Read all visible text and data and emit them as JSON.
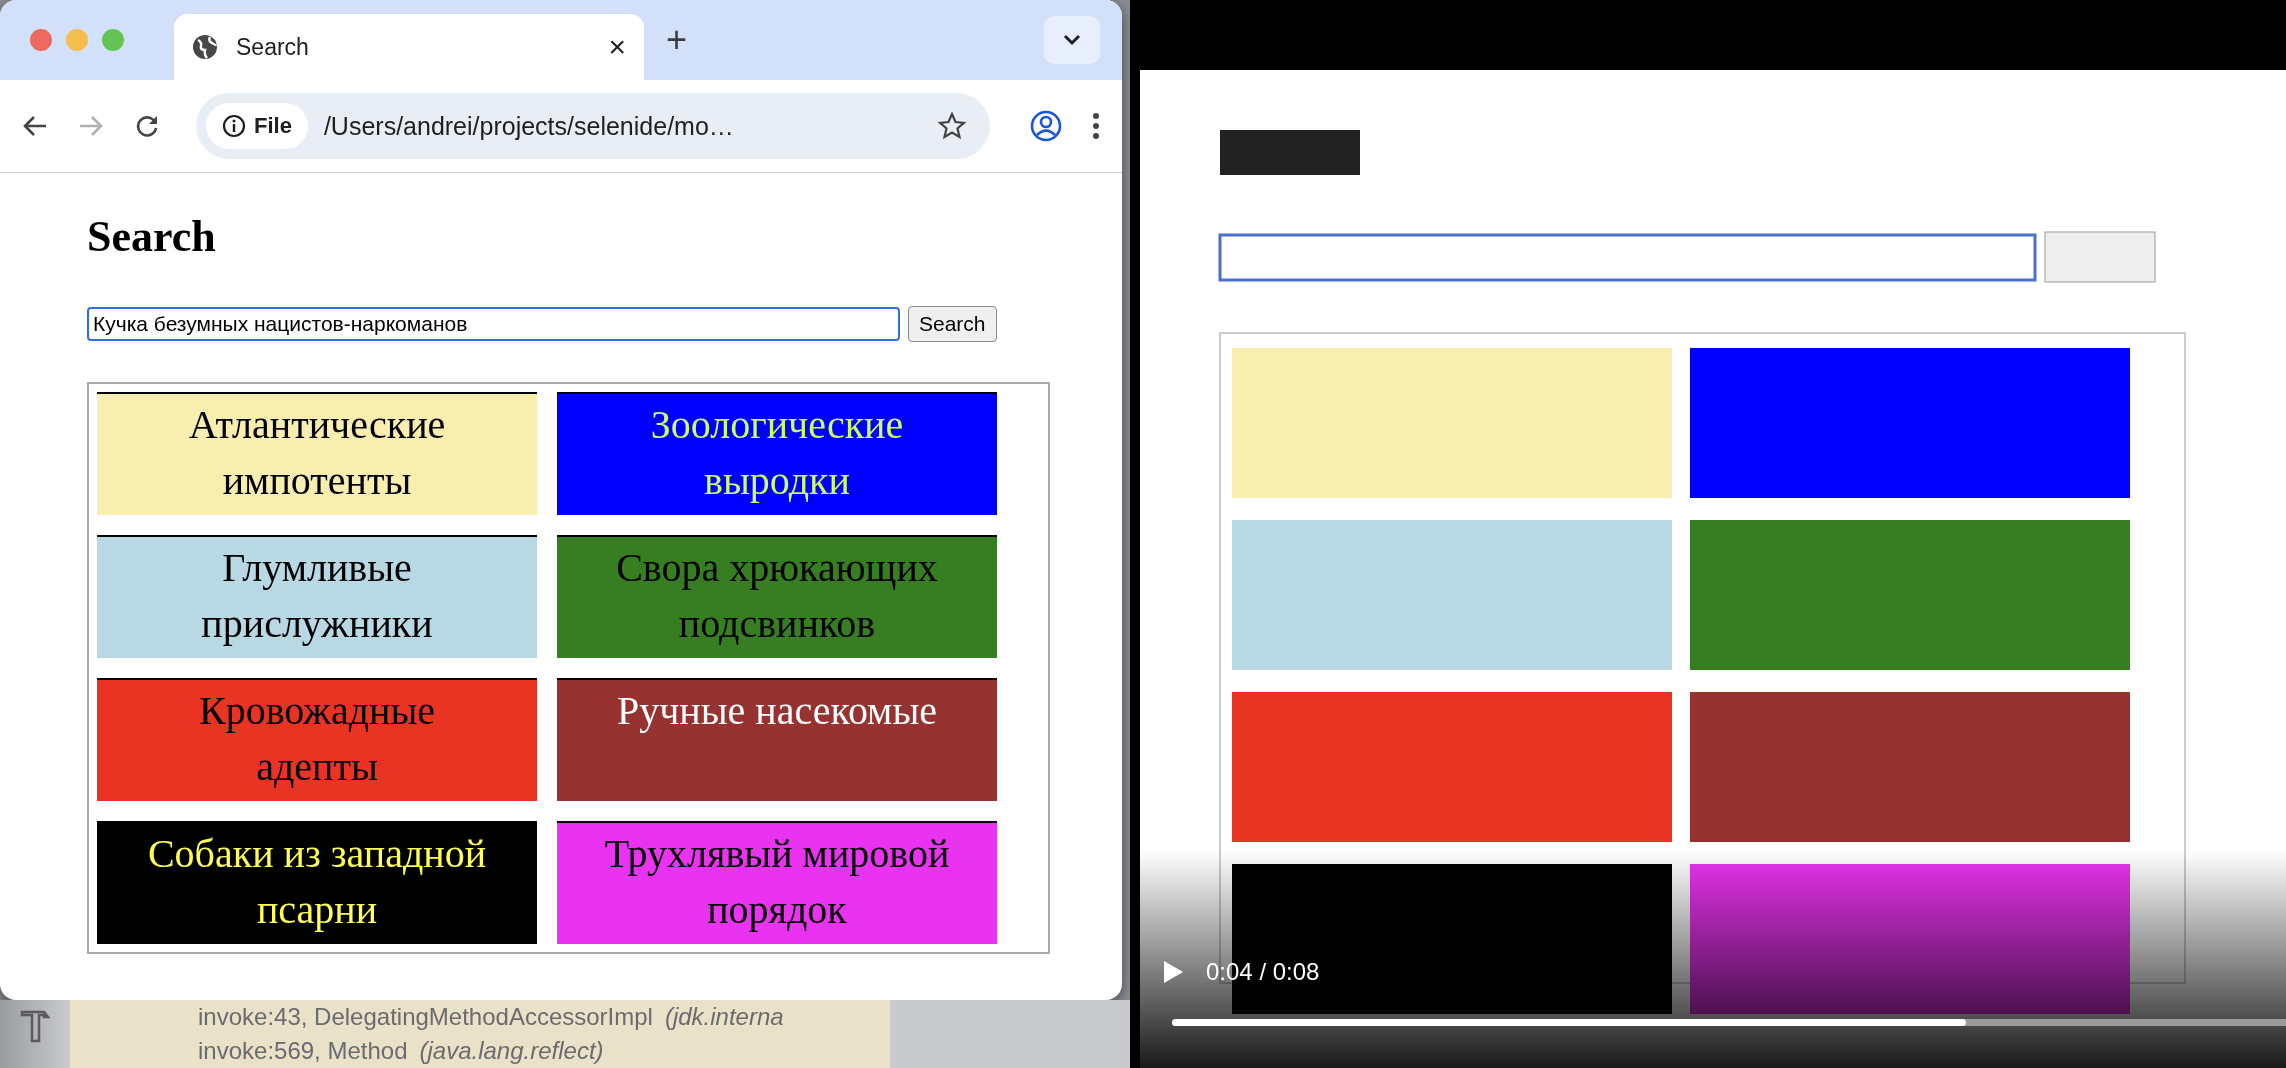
{
  "browser": {
    "tab": {
      "title": "Search",
      "close": "×"
    },
    "new_tab": "+",
    "address_bar": {
      "badge": "File",
      "url": "/Users/andrei/projects/selenide/mo…"
    },
    "forward_disabled": true,
    "page": {
      "heading": "Search",
      "search_field": {
        "value": "Кучка безумных нацистов-наркоманов"
      },
      "search_button": "Search",
      "tiles": [
        {
          "label": "Атлантические импотенты",
          "color": "#f8eeb0",
          "ink": {
            "color": "#000000"
          }
        },
        {
          "label": "Зоологические выродки",
          "color": "#0000ff",
          "ink": {
            "color": "#ccff66"
          }
        },
        {
          "label": "Глумливые прислужники",
          "color": "#b8d8e4",
          "ink": {
            "color": "#000000"
          }
        },
        {
          "label": "Свора хрюкающих подсвинков",
          "color": "#367e21",
          "ink": {
            "color": "#000000"
          }
        },
        {
          "label": "Кровожадные адепты",
          "color": "#e93424",
          "ink": {
            "color": "#000000"
          }
        },
        {
          "label": "Ручные насекомые",
          "color": "#963230",
          "ink": {
            "color": "#ffffff"
          }
        },
        {
          "label": "Собаки из западной псарни",
          "color": "#000000",
          "ink": {
            "color": "#ffff55"
          }
        },
        {
          "label": "Трухлявый мировой порядок",
          "color": "#ea33f0",
          "ink": {
            "color": "#000000"
          }
        }
      ]
    }
  },
  "ide": {
    "lines": [
      {
        "text": "invoke:43, DelegatingMethodAccessorImpl",
        "package": "(jdk.interna"
      },
      {
        "text": "invoke:569, Method",
        "package": "(java.lang.reflect)"
      }
    ]
  },
  "video_player": {
    "time": "0:04 / 0:08",
    "progress": {
      "level": 0.7
    }
  }
}
